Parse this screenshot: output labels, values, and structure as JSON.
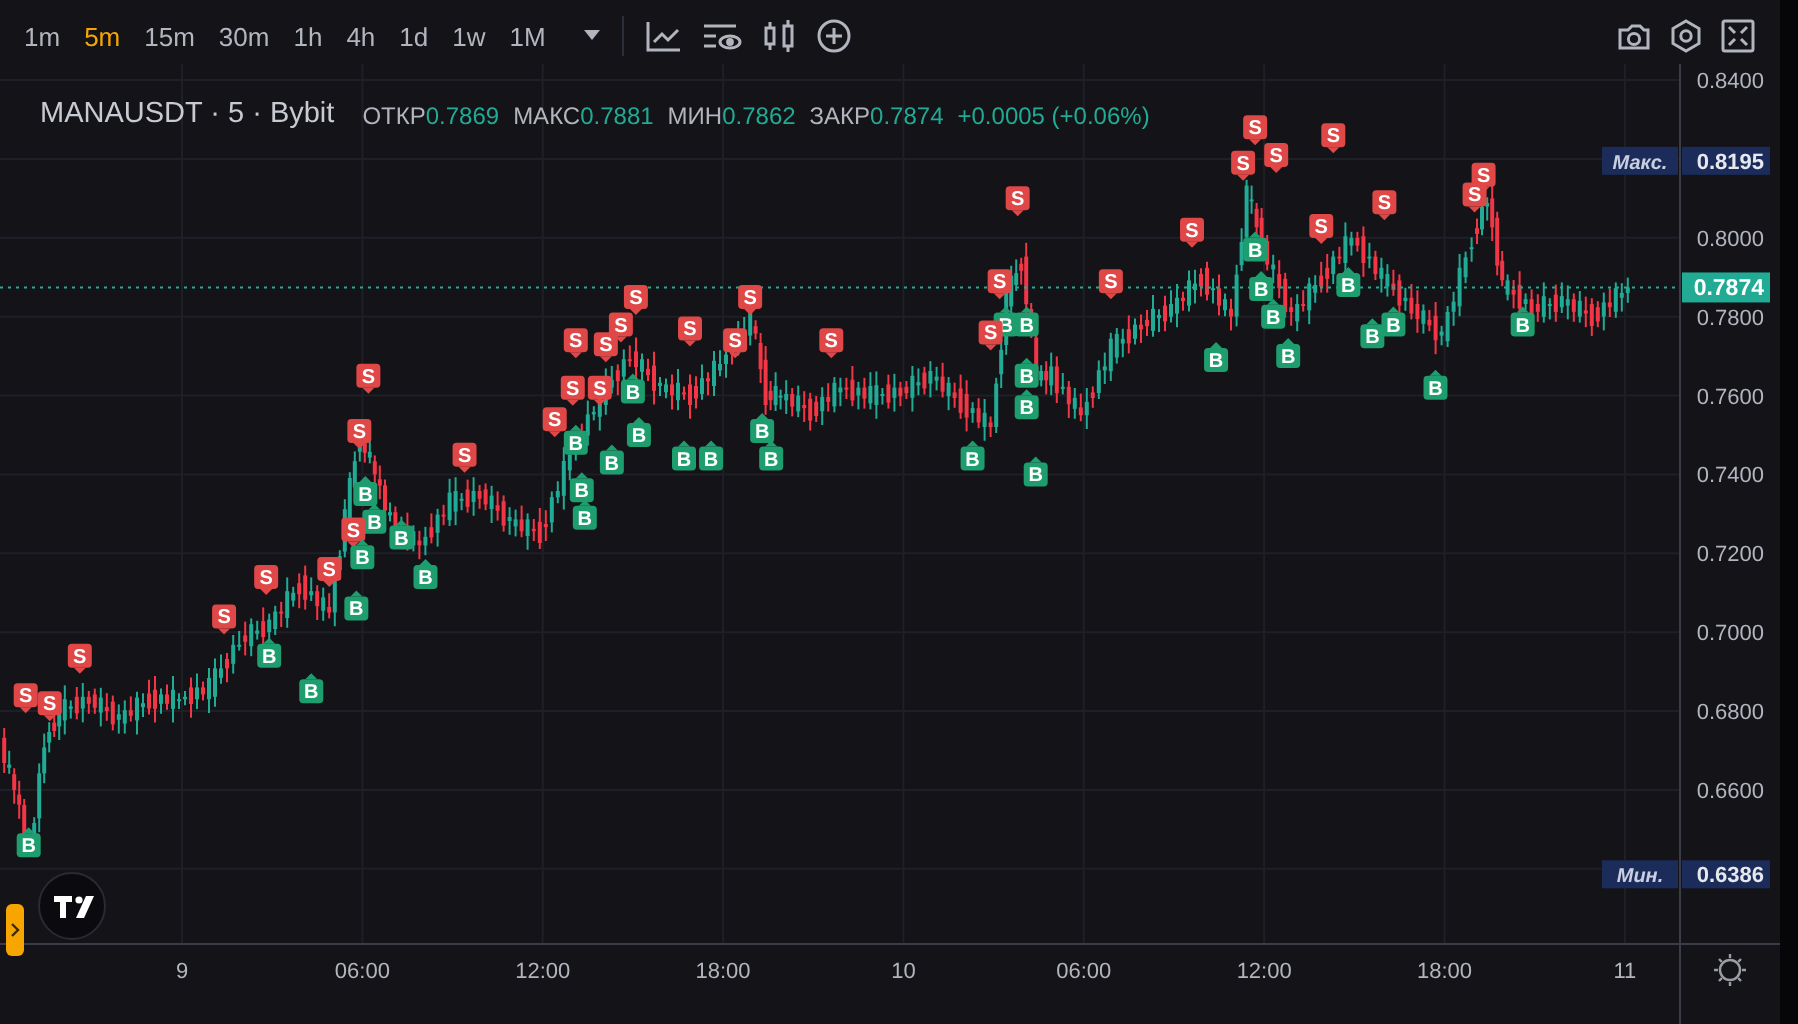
{
  "toolbar": {
    "intervals": [
      {
        "label": "1m",
        "selected": false
      },
      {
        "label": "5m",
        "selected": true
      },
      {
        "label": "15m",
        "selected": false
      },
      {
        "label": "30m",
        "selected": false
      },
      {
        "label": "1h",
        "selected": false
      },
      {
        "label": "4h",
        "selected": false
      },
      {
        "label": "1d",
        "selected": false
      },
      {
        "label": "1w",
        "selected": false
      },
      {
        "label": "1M",
        "selected": false
      }
    ]
  },
  "legend": {
    "symbol": "MANAUSDT · 5 · Bybit",
    "ohlc": [
      {
        "label": "ОТКР",
        "value": "0.7869"
      },
      {
        "label": "МАКС",
        "value": "0.7881"
      },
      {
        "label": "МИН",
        "value": "0.7862"
      },
      {
        "label": "ЗАКР",
        "value": "0.7874"
      }
    ],
    "change": "+0.0005 (+0.06%)"
  },
  "price_axis": {
    "labels": [
      "0.8400",
      "0.8000",
      "0.7800",
      "0.7600",
      "0.7400",
      "0.7200",
      "0.7000",
      "0.6800",
      "0.6600"
    ],
    "max_tag": {
      "label": "Макс.",
      "value": "0.8195"
    },
    "min_tag": {
      "label": "Мин.",
      "value": "0.6386"
    },
    "last_price": "0.7874"
  },
  "time_axis": {
    "labels": [
      "9",
      "06:00",
      "12:00",
      "18:00",
      "10",
      "06:00",
      "12:00",
      "18:00",
      "11"
    ]
  },
  "signals": [
    {
      "kind": "sell",
      "label": "S"
    },
    {
      "kind": "sell",
      "label": "S"
    },
    {
      "kind": "buy",
      "label": "B"
    },
    {
      "kind": "sell",
      "label": "S"
    },
    {
      "kind": "sell",
      "label": "S"
    },
    {
      "kind": "sell",
      "label": "S"
    },
    {
      "kind": "buy",
      "label": "B"
    },
    {
      "kind": "sell",
      "label": "S"
    },
    {
      "kind": "buy",
      "label": "B"
    },
    {
      "kind": "sell",
      "label": "S"
    },
    {
      "kind": "sell",
      "label": "S"
    },
    {
      "kind": "buy",
      "label": "B"
    },
    {
      "kind": "buy",
      "label": "B"
    },
    {
      "kind": "sell",
      "label": "S"
    },
    {
      "kind": "buy",
      "label": "B"
    },
    {
      "kind": "buy",
      "label": "B"
    },
    {
      "kind": "buy",
      "label": "B"
    },
    {
      "kind": "buy",
      "label": "B"
    },
    {
      "kind": "sell",
      "label": "S"
    },
    {
      "kind": "sell",
      "label": "S"
    },
    {
      "kind": "sell",
      "label": "S"
    },
    {
      "kind": "sell",
      "label": "S"
    },
    {
      "kind": "sell",
      "label": "S"
    },
    {
      "kind": "sell",
      "label": "S"
    },
    {
      "kind": "sell",
      "label": "S"
    },
    {
      "kind": "buy",
      "label": "B"
    },
    {
      "kind": "sell",
      "label": "S"
    },
    {
      "kind": "buy",
      "label": "B"
    },
    {
      "kind": "buy",
      "label": "B"
    },
    {
      "kind": "buy",
      "label": "B"
    },
    {
      "kind": "buy",
      "label": "B"
    },
    {
      "kind": "buy",
      "label": "B"
    },
    {
      "kind": "sell",
      "label": "S"
    },
    {
      "kind": "buy",
      "label": "B"
    },
    {
      "kind": "buy",
      "label": "B"
    },
    {
      "kind": "sell",
      "label": "S"
    },
    {
      "kind": "sell",
      "label": "S"
    },
    {
      "kind": "buy",
      "label": "B"
    },
    {
      "kind": "buy",
      "label": "B"
    },
    {
      "kind": "sell",
      "label": "S"
    },
    {
      "kind": "sell",
      "label": "S"
    },
    {
      "kind": "sell",
      "label": "S"
    },
    {
      "kind": "buy",
      "label": "B"
    },
    {
      "kind": "buy",
      "label": "B"
    },
    {
      "kind": "sell",
      "label": "S"
    },
    {
      "kind": "buy",
      "label": "B"
    },
    {
      "kind": "buy",
      "label": "B"
    },
    {
      "kind": "buy",
      "label": "B"
    },
    {
      "kind": "buy",
      "label": "B"
    },
    {
      "kind": "sell",
      "label": "S"
    },
    {
      "kind": "sell",
      "label": "S"
    },
    {
      "kind": "buy",
      "label": "B"
    },
    {
      "kind": "sell",
      "label": "S"
    },
    {
      "kind": "sell",
      "label": "S"
    },
    {
      "kind": "sell",
      "label": "S"
    },
    {
      "kind": "buy",
      "label": "B"
    },
    {
      "kind": "buy",
      "label": "B"
    },
    {
      "kind": "buy",
      "label": "B"
    },
    {
      "kind": "buy",
      "label": "B"
    },
    {
      "kind": "sell",
      "label": "S"
    },
    {
      "kind": "sell",
      "label": "S"
    },
    {
      "kind": "sell",
      "label": "S"
    },
    {
      "kind": "buy",
      "label": "B"
    },
    {
      "kind": "buy",
      "label": "B"
    },
    {
      "kind": "buy",
      "label": "B"
    },
    {
      "kind": "buy",
      "label": "B"
    },
    {
      "kind": "sell",
      "label": "S"
    },
    {
      "kind": "sell",
      "label": "S"
    },
    {
      "kind": "buy",
      "label": "B"
    }
  ]
}
